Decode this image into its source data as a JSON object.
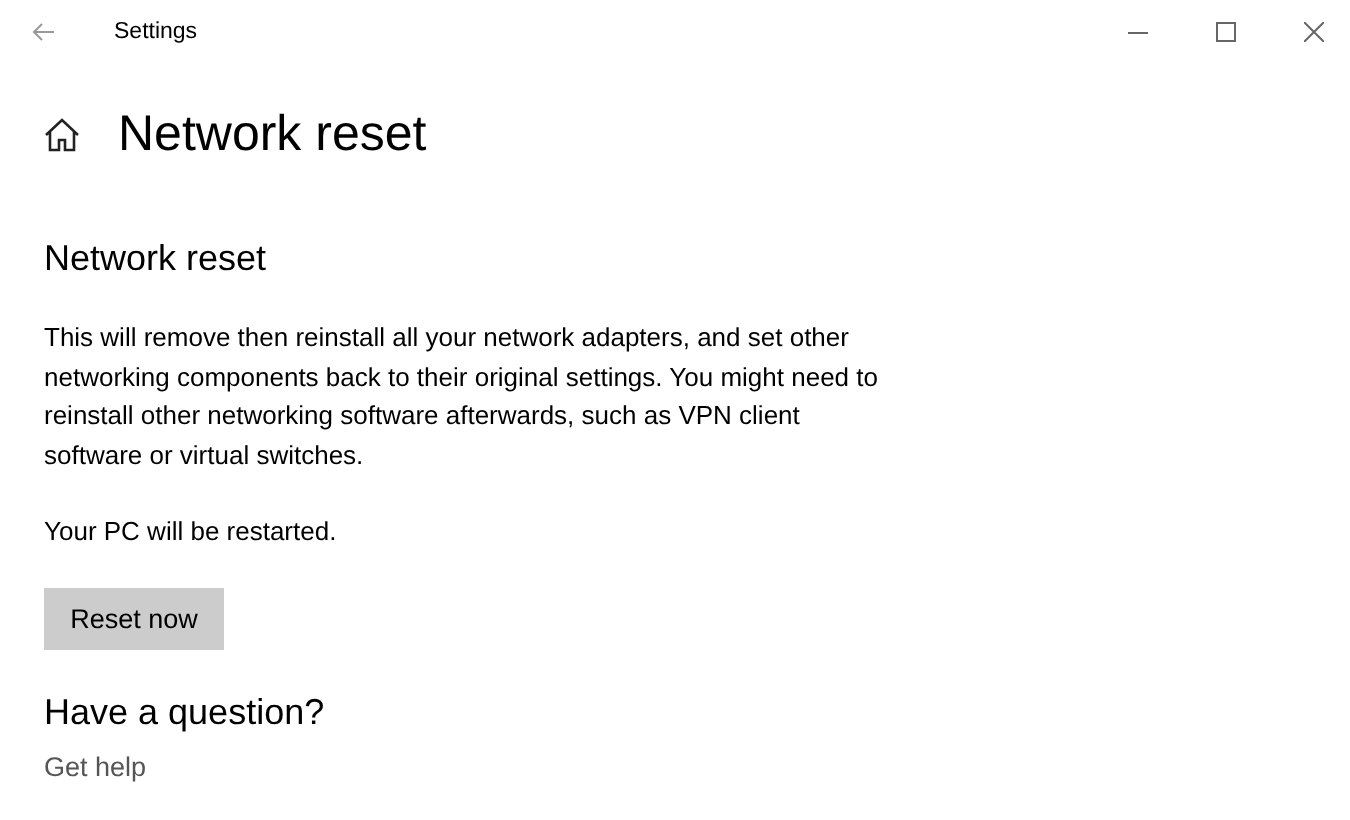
{
  "window": {
    "title": "Settings"
  },
  "page_title": "Network reset",
  "section": {
    "heading": "Network reset",
    "description": "This will remove then reinstall all your network adapters, and set other networking components back to their original settings. You might need to reinstall other networking software afterwards, such as VPN client software or virtual switches.",
    "note": "Your PC will be restarted.",
    "button": "Reset now"
  },
  "help": {
    "heading": "Have a question?",
    "link": "Get help"
  }
}
